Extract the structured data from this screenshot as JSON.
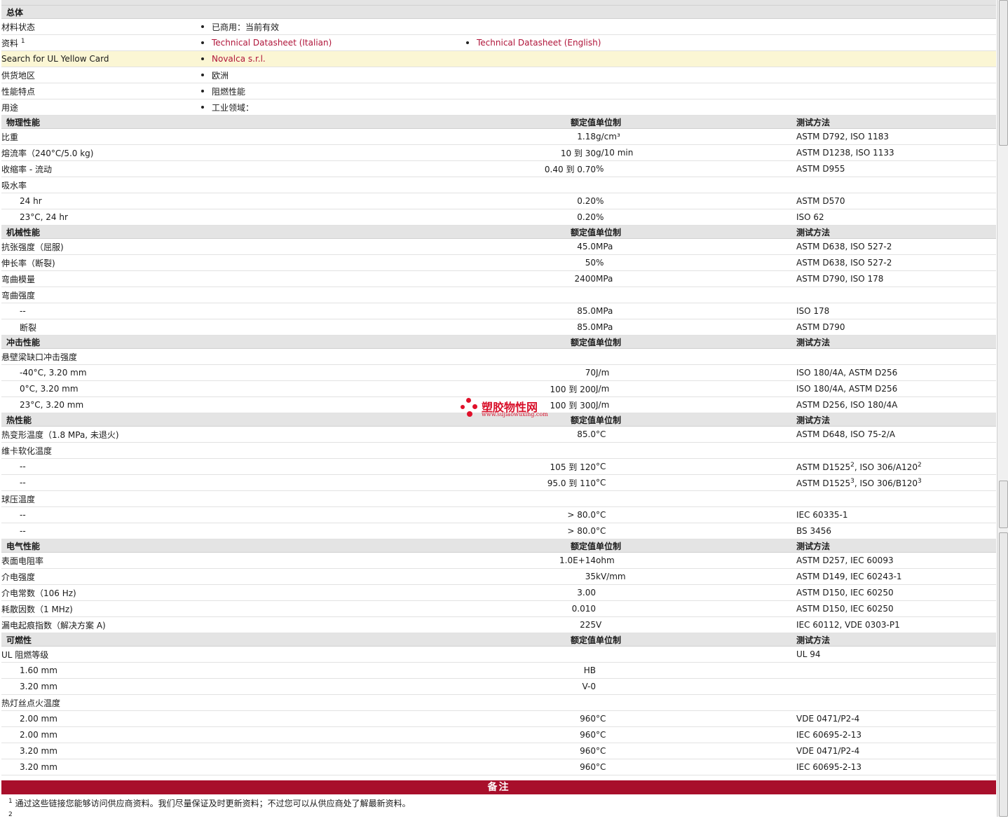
{
  "general": {
    "title": "总体",
    "status_label": "材料状态",
    "status_value": "已商用：当前有效",
    "docs_label": "资料",
    "docs_sup": "1",
    "doc1": "Technical Datasheet (Italian)",
    "doc2": "Technical Datasheet (English)",
    "ul_label": "Search for UL Yellow Card",
    "ul_value": "Novalca s.r.l.",
    "region_label": "供货地区",
    "region_value": "欧洲",
    "feature_label": "性能特点",
    "feature_value": "阻燃性能",
    "usage_label": "用途",
    "usage_value": "工业领域："
  },
  "columns": {
    "nominal": "额定值",
    "unit": "单位制",
    "method": "测试方法"
  },
  "physical": {
    "title": "物理性能",
    "rows": [
      {
        "label": "比重",
        "value": "1.18",
        "unit": "g/cm³",
        "method": "ASTM D792, ISO 1183"
      },
      {
        "label": "熔流率（240°C/5.0 kg)",
        "value": "10 到  30",
        "unit": "g/10 min",
        "method": "ASTM D1238, ISO 1133"
      },
      {
        "label": "收缩率  - 流动",
        "value": "0.40 到  0.70",
        "unit": "%",
        "method": "ASTM D955"
      },
      {
        "label": "吸水率",
        "value": "",
        "unit": "",
        "method": ""
      },
      {
        "label": "24 hr",
        "value": "0.20",
        "unit": "%",
        "method": "ASTM D570"
      },
      {
        "label": "23°C, 24 hr",
        "value": "0.20",
        "unit": "%",
        "method": "ISO 62"
      }
    ]
  },
  "mechanical": {
    "title": "机械性能",
    "rows": [
      {
        "label": "抗张强度（屈服)",
        "value": "45.0",
        "unit": "MPa",
        "method": "ASTM D638, ISO 527-2"
      },
      {
        "label": "伸长率（断裂)",
        "value": "50",
        "unit": "%",
        "method": "ASTM D638, ISO 527-2"
      },
      {
        "label": "弯曲模量",
        "value": "2400",
        "unit": "MPa",
        "method": "ASTM D790, ISO 178"
      },
      {
        "label": "弯曲强度",
        "value": "",
        "unit": "",
        "method": ""
      },
      {
        "label": "--",
        "value": "85.0",
        "unit": "MPa",
        "method": "ISO 178"
      },
      {
        "label": "断裂",
        "value": "85.0",
        "unit": "MPa",
        "method": "ASTM D790"
      }
    ]
  },
  "impact": {
    "title": "冲击性能",
    "rows": [
      {
        "label": "悬壁梁缺口冲击强度",
        "value": "",
        "unit": "",
        "method": ""
      },
      {
        "label": "-40°C, 3.20 mm",
        "value": "70",
        "unit": "J/m",
        "method": "ISO 180/4A, ASTM D256"
      },
      {
        "label": "0°C, 3.20 mm",
        "value": "100 到  200",
        "unit": "J/m",
        "method": "ISO 180/4A, ASTM D256"
      },
      {
        "label": "23°C, 3.20 mm",
        "value": "100 到  300",
        "unit": "J/m",
        "method": "ASTM D256, ISO 180/4A"
      }
    ]
  },
  "thermal": {
    "title": "热性能",
    "rows": [
      {
        "label": "热变形温度（1.8 MPa, 未退火)",
        "value": "85.0",
        "unit": "°C",
        "method": "ASTM D648, ISO 75-2/A"
      },
      {
        "label": "维卡软化温度",
        "value": "",
        "unit": "",
        "method": ""
      },
      {
        "label": "--",
        "value": "105 到  120",
        "unit": "°C",
        "m1": "ASTM D1525",
        "s1": "2",
        "m2": ", ISO 306/A120",
        "s2": "2"
      },
      {
        "label": "--",
        "value": "95.0 到  110",
        "unit": "°C",
        "m1": "ASTM D1525",
        "s1": "3",
        "m2": ", ISO 306/B120",
        "s2": "3"
      },
      {
        "label": "球压温度",
        "value": "",
        "unit": "",
        "method": ""
      },
      {
        "label": "--",
        "value": "> 80.0",
        "unit": "°C",
        "method": "IEC 60335-1"
      },
      {
        "label": "--",
        "value": "> 80.0",
        "unit": "°C",
        "method": "BS 3456"
      }
    ]
  },
  "electrical": {
    "title": "电气性能",
    "rows": [
      {
        "label": "表面电阻率",
        "value": "1.0E+14",
        "unit": "ohm",
        "method": "ASTM D257, IEC 60093"
      },
      {
        "label": "介电强度",
        "value": "35",
        "unit": "kV/mm",
        "method": "ASTM D149, IEC 60243-1"
      },
      {
        "label": "介电常数（106 Hz)",
        "value": "3.00",
        "unit": "",
        "method": "ASTM D150, IEC 60250"
      },
      {
        "label": "耗散因数（1 MHz)",
        "value": "0.010",
        "unit": "",
        "method": "ASTM D150, IEC 60250"
      },
      {
        "label": "漏电起痕指数（解决方案  A)",
        "value": "225",
        "unit": "V",
        "method": "IEC 60112, VDE 0303-P1"
      }
    ]
  },
  "flammability": {
    "title": "可燃性",
    "rows": [
      {
        "label": "UL 阻燃等级",
        "value": "",
        "unit": "",
        "method": "UL 94"
      },
      {
        "label": "1.60 mm",
        "value": "HB",
        "unit": "",
        "method": ""
      },
      {
        "label": "3.20 mm",
        "value": "V-0",
        "unit": "",
        "method": ""
      },
      {
        "label": "热灯丝点火温度",
        "value": "",
        "unit": "",
        "method": ""
      },
      {
        "label": "2.00 mm",
        "value": "960",
        "unit": "°C",
        "method": "VDE 0471/P2-4"
      },
      {
        "label": "2.00 mm",
        "value": "960",
        "unit": "°C",
        "method": "IEC 60695-2-13"
      },
      {
        "label": "3.20 mm",
        "value": "960",
        "unit": "°C",
        "method": "VDE 0471/P2-4"
      },
      {
        "label": "3.20 mm",
        "value": "960",
        "unit": "°C",
        "method": "IEC 60695-2-13"
      }
    ]
  },
  "notes": {
    "title": "备注",
    "n1_sup": "1",
    "n1_text": "通过这些链接您能够访问供应商资料。我们尽量保证及时更新资料；不过您可以从供应商处了解最新资料。",
    "n2_sup": "2"
  },
  "watermark": {
    "text": "塑胶物性网",
    "url": "www.sujiaowuxing.com"
  }
}
